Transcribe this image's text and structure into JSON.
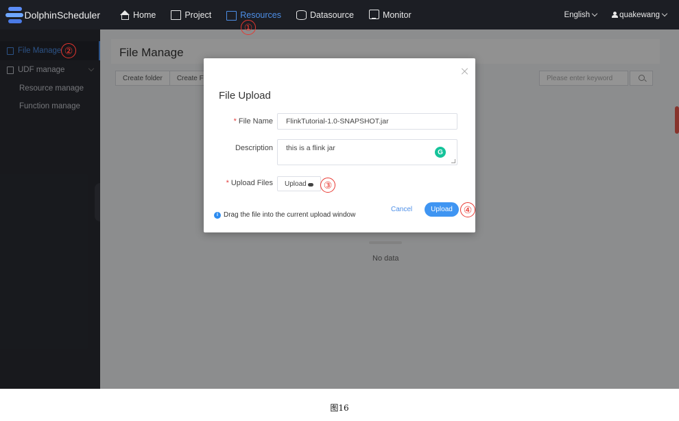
{
  "app": {
    "name": "DolphinScheduler"
  },
  "nav": [
    {
      "label": "Home",
      "icon": "home-icon",
      "active": false
    },
    {
      "label": "Project",
      "icon": "project-icon",
      "active": false
    },
    {
      "label": "Resources",
      "icon": "folder-icon",
      "active": true
    },
    {
      "label": "Datasource",
      "icon": "database-icon",
      "active": false
    },
    {
      "label": "Monitor",
      "icon": "monitor-icon",
      "active": false
    }
  ],
  "topright": {
    "language": "English",
    "user": "quakewang"
  },
  "sidebar": {
    "items": [
      {
        "label": "File Manage",
        "active": true
      },
      {
        "label": "UDF manage",
        "active": false
      },
      {
        "label": "Resource manage",
        "active": false
      },
      {
        "label": "Function manage",
        "active": false
      }
    ]
  },
  "main": {
    "title": "File Manage",
    "buttons": [
      "Create folder",
      "Create File"
    ],
    "search_placeholder": "Please enter keyword",
    "empty_text": "No data"
  },
  "modal": {
    "title": "File Upload",
    "file_name_label": "File Name",
    "file_name_value": "FlinkTutorial-1.0-SNAPSHOT.jar",
    "description_label": "Description",
    "description_value": "this is a flink jar",
    "upload_files_label": "Upload Files",
    "upload_button": "Upload",
    "hint": "Drag the file into the current upload window",
    "cancel": "Cancel",
    "submit": "Upload"
  },
  "annotations": [
    "①",
    "②",
    "③",
    "④"
  ],
  "caption": "图16",
  "colors": {
    "accent": "#4d8fe8",
    "topbar": "#1c1e24",
    "sidebar": "#2a2c33",
    "annotation": "#e8362f",
    "primary_button": "#3f95f2"
  }
}
